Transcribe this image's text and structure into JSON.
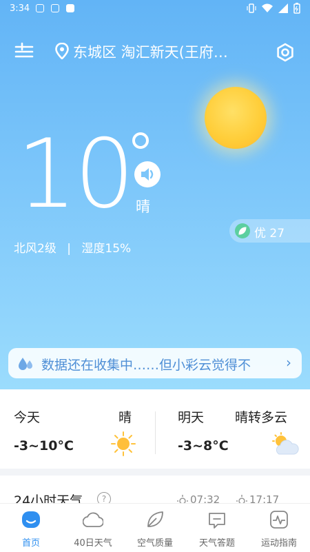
{
  "status_bar": {
    "time": "3:34"
  },
  "header": {
    "location": "东城区 淘汇新天(王府…"
  },
  "current": {
    "temperature": "10",
    "condition": "晴",
    "wind": "北风2级",
    "separator": "|",
    "humidity": "湿度15%"
  },
  "aqi": {
    "text": "优 27"
  },
  "notice": {
    "text": "数据还在收集中……但小彩云觉得不",
    "arrow": "›"
  },
  "forecast": {
    "today": {
      "label": "今天",
      "condition": "晴",
      "range": "-3~10°C"
    },
    "tomorrow": {
      "label": "明天",
      "condition": "晴转多云",
      "range": "-3~8°C"
    }
  },
  "hourly": {
    "title": "24小时天气",
    "help": "?",
    "sunrise": "07:32",
    "sunset": "17:17"
  },
  "nav": {
    "items": [
      {
        "label": "首页"
      },
      {
        "label": "40日天气"
      },
      {
        "label": "空气质量"
      },
      {
        "label": "天气答题"
      },
      {
        "label": "运动指南"
      }
    ]
  },
  "colors": {
    "accent": "#2f8ff0",
    "sky_top": "#62b4f6",
    "sky_bottom": "#9bdcfd",
    "notice_text": "#4f8fd6"
  },
  "icons": [
    "menu-icon",
    "location-pin-icon",
    "settings-icon",
    "speaker-icon",
    "leaf-icon",
    "raindrops-icon",
    "sun-icon",
    "partly-cloudy-icon"
  ]
}
